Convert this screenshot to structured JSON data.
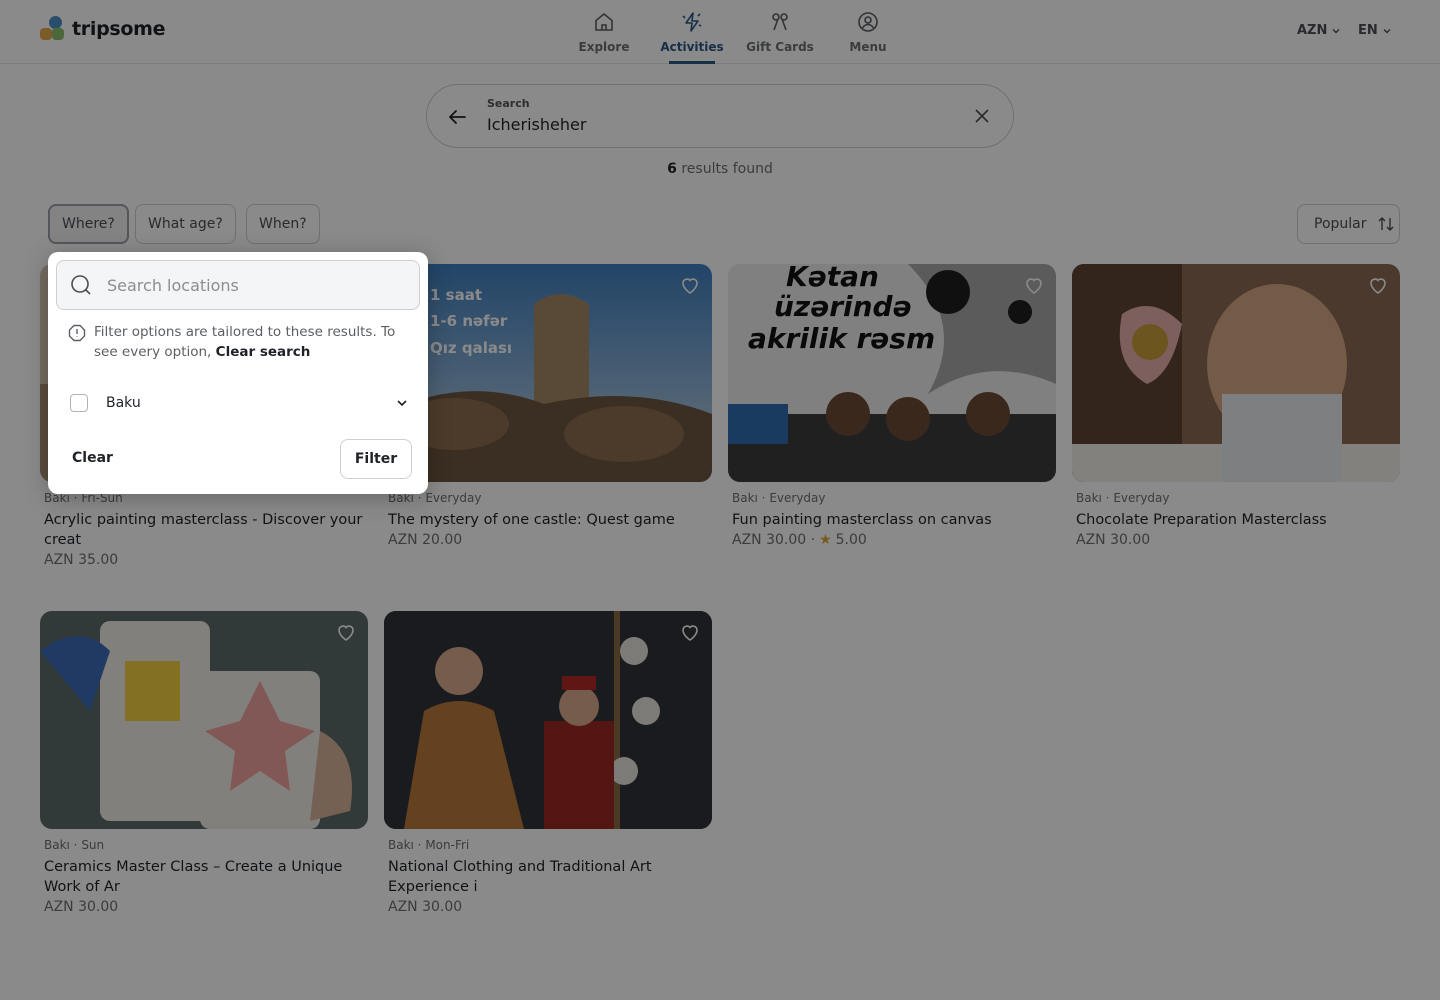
{
  "brand": {
    "name": "tripsome"
  },
  "nav": [
    {
      "label": "Explore",
      "icon": "home-icon",
      "active": false
    },
    {
      "label": "Activities",
      "icon": "activities-icon",
      "active": true
    },
    {
      "label": "Gift Cards",
      "icon": "gift-icon",
      "active": false
    },
    {
      "label": "Menu",
      "icon": "user-circle-icon",
      "active": false
    }
  ],
  "currency": "AZN",
  "language": "EN",
  "search": {
    "label": "Search",
    "value": "Icherisheher"
  },
  "results": {
    "count": "6",
    "text": "results found"
  },
  "filters": {
    "where": "Where?",
    "age": "What age?",
    "when": "When?",
    "sort": "Popular"
  },
  "popover": {
    "search_placeholder": "Search locations",
    "info_text": "Filter options are tailored to these results. To see every option,",
    "info_link": "Clear search",
    "option": "Baku",
    "clear": "Clear",
    "filter": "Filter"
  },
  "cards": [
    {
      "meta": "Bakı · Fri-Sun",
      "title": "Acrylic painting masterclass - Discover your creat",
      "price": "AZN 35.00"
    },
    {
      "meta": "Bakı · Everyday",
      "title": "The mystery of one castle: Quest game",
      "price": "AZN 20.00",
      "overlay": [
        "1 saat",
        "1-6 nəfər",
        "Qız qalası"
      ]
    },
    {
      "meta": "Bakı · Everyday",
      "title": "Fun painting masterclass on canvas",
      "price": "AZN 30.00 ·",
      "rating": "5.00",
      "overlay": [
        "Kətan",
        "üzərində",
        "akrilik rəsm"
      ]
    },
    {
      "meta": "Bakı · Everyday",
      "title": "Chocolate Preparation Masterclass",
      "price": "AZN 30.00"
    },
    {
      "meta": "Bakı · Sun",
      "title": "Ceramics Master Class – Create a Unique Work of Ar",
      "price": "AZN 30.00"
    },
    {
      "meta": "Bakı · Mon-Fri",
      "title": "National Clothing and Traditional Art Experience i",
      "price": "AZN 30.00"
    }
  ],
  "colors": {
    "accent": "#2b5a85",
    "star": "#e1a43a"
  }
}
